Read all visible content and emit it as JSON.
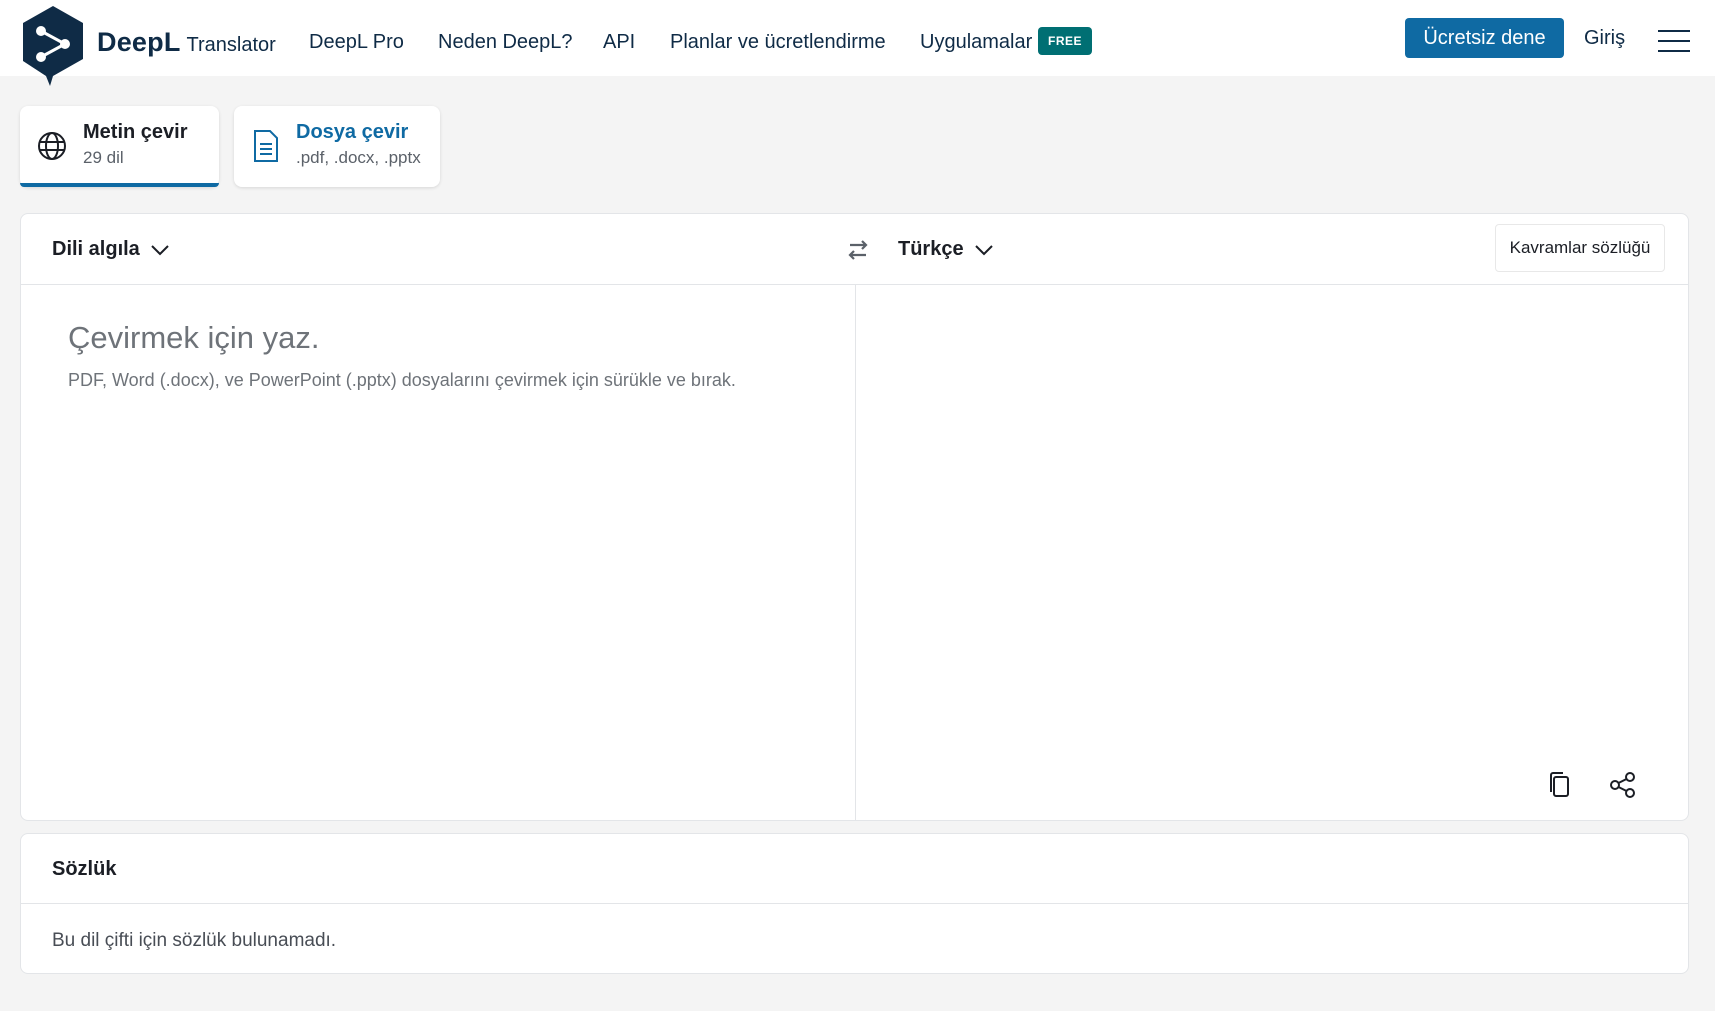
{
  "header": {
    "brand_name": "DeepL",
    "brand_sub": "Translator",
    "nav": [
      "DeepL Pro",
      "Neden DeepL?",
      "API",
      "Planlar ve ücretlendirme",
      "Uygulamalar"
    ],
    "badge_free": "FREE",
    "try_button": "Ücretsiz dene",
    "login": "Giriş"
  },
  "tabs": {
    "text": {
      "title": "Metin çevir",
      "sub": "29 dil"
    },
    "file": {
      "title": "Dosya çevir",
      "sub": ".pdf, .docx, .pptx"
    }
  },
  "translator": {
    "source_lang": "Dili algıla",
    "target_lang": "Türkçe",
    "glossary_button": "Kavramlar sözlüğü",
    "placeholder": "Çevirmek için yaz.",
    "placeholder_hint": "PDF, Word (.docx), ve PowerPoint (.pptx) dosyalarını çevirmek için sürükle ve bırak."
  },
  "dictionary": {
    "title": "Sözlük",
    "message": "Bu dil çifti için sözlük bulunamadı."
  },
  "colors": {
    "brand_dark": "#0f2b46",
    "primary": "#0f6aa3",
    "badge": "#006f73"
  }
}
